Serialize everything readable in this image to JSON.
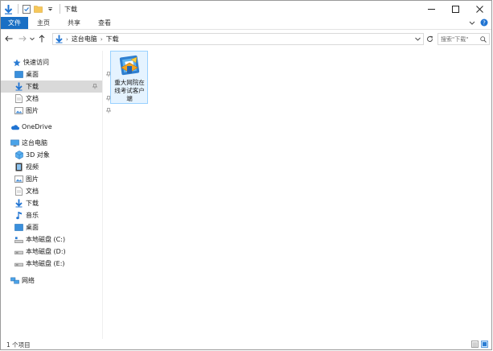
{
  "window": {
    "title": "下载",
    "accent": "#1a6fc4"
  },
  "ribbon": {
    "tabs": [
      "文件",
      "主页",
      "共享",
      "查看"
    ]
  },
  "address": {
    "crumbs": [
      "这台电脑",
      "下载"
    ],
    "search_placeholder": "搜索\"下载\""
  },
  "nav": {
    "quick_access": "快速访问",
    "quick_items": [
      "桌面",
      "下载",
      "文档",
      "图片"
    ],
    "onedrive": "OneDrive",
    "this_pc": "这台电脑",
    "pc_items": [
      "3D 对象",
      "视频",
      "图片",
      "文档",
      "下载",
      "音乐",
      "桌面",
      "本地磁盘 (C:)",
      "本地磁盘 (D:)",
      "本地磁盘 (E:)"
    ],
    "network": "网络"
  },
  "files": [
    {
      "name": "重大网院在线考试客户端",
      "icon": "exam-client-app-icon"
    }
  ],
  "status": {
    "count": "1 个项目"
  }
}
